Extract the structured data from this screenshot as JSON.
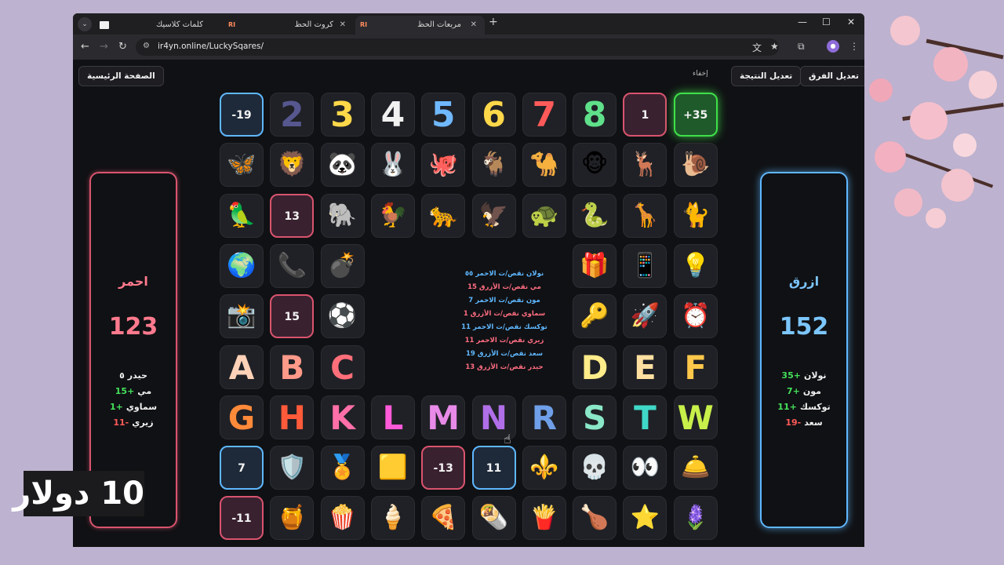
{
  "browser": {
    "tabs": [
      {
        "title": "كلمات كلاسيك",
        "active": false
      },
      {
        "title": "كروت الحظ",
        "active": false
      },
      {
        "title": "مربعات الحظ",
        "active": true
      }
    ],
    "url": "ir4yn.online/LuckySqares/"
  },
  "header": {
    "home_button": "الصفحة الرئيسية",
    "edit_score_button": "تعديل النتيجة",
    "edit_teams_button": "تعديل الفرق",
    "hide_label": "إخفاء"
  },
  "teams": {
    "red": {
      "name": "احمر",
      "score": "123",
      "color": "#ff7a8e",
      "players": [
        {
          "name": "حيدر",
          "value": "٥",
          "kind": "plain"
        },
        {
          "name": "مي",
          "value": "+15",
          "kind": "pos"
        },
        {
          "name": "سماوي",
          "value": "+1",
          "kind": "pos"
        },
        {
          "name": "زيري",
          "value": "-11",
          "kind": "neg"
        }
      ]
    },
    "blue": {
      "name": "ازرق",
      "score": "152",
      "color": "#7cc6ff",
      "players": [
        {
          "name": "نولان",
          "value": "+35",
          "kind": "pos"
        },
        {
          "name": "مون",
          "value": "+7",
          "kind": "pos"
        },
        {
          "name": "توكسك",
          "value": "+11",
          "kind": "pos"
        },
        {
          "name": "سعد",
          "value": "-19",
          "kind": "neg"
        }
      ]
    }
  },
  "grid": [
    [
      {
        "t": "-19",
        "k": "val",
        "s": "blue"
      },
      {
        "t": "2",
        "k": "num",
        "c": "#56578f"
      },
      {
        "t": "3",
        "k": "num",
        "c": "#ffd84a"
      },
      {
        "t": "4",
        "k": "num",
        "c": "#f1f1f1"
      },
      {
        "t": "5",
        "k": "num",
        "c": "#6fb8ff"
      },
      {
        "t": "6",
        "k": "num",
        "c": "#ffd84a"
      },
      {
        "t": "7",
        "k": "num",
        "c": "#ff5a5a"
      },
      {
        "t": "8",
        "k": "num",
        "c": "#5fe08a"
      },
      {
        "t": "1",
        "k": "val",
        "s": "red"
      },
      {
        "t": "+35",
        "k": "val",
        "s": "green"
      }
    ],
    [
      {
        "t": "🦋",
        "k": "emo"
      },
      {
        "t": "🦁",
        "k": "emo"
      },
      {
        "t": "🐼",
        "k": "emo"
      },
      {
        "t": "🐰",
        "k": "emo"
      },
      {
        "t": "🐙",
        "k": "emo"
      },
      {
        "t": "🐐",
        "k": "emo"
      },
      {
        "t": "🐪",
        "k": "emo"
      },
      {
        "t": "🐵",
        "k": "emo"
      },
      {
        "t": "🦌",
        "k": "emo"
      },
      {
        "t": "🐌",
        "k": "emo"
      }
    ],
    [
      {
        "t": "🦜",
        "k": "emo"
      },
      {
        "t": "13",
        "k": "val",
        "s": "red"
      },
      {
        "t": "🐘",
        "k": "emo"
      },
      {
        "t": "🐓",
        "k": "emo"
      },
      {
        "t": "🐆",
        "k": "emo"
      },
      {
        "t": "🦅",
        "k": "emo"
      },
      {
        "t": "🐢",
        "k": "emo"
      },
      {
        "t": "🐍",
        "k": "emo"
      },
      {
        "t": "🦒",
        "k": "emo"
      },
      {
        "t": "🐈",
        "k": "emo"
      }
    ],
    [
      {
        "t": "🌍",
        "k": "emo"
      },
      {
        "t": "📞",
        "k": "emo"
      },
      {
        "t": "💣",
        "k": "emo"
      },
      null,
      null,
      null,
      null,
      {
        "t": "🎁",
        "k": "emo"
      },
      {
        "t": "📱",
        "k": "emo"
      },
      {
        "t": "💡",
        "k": "emo"
      }
    ],
    [
      {
        "t": "📸",
        "k": "emo"
      },
      {
        "t": "15",
        "k": "val",
        "s": "red"
      },
      {
        "t": "⚽",
        "k": "emo"
      },
      null,
      null,
      null,
      null,
      {
        "t": "🔑",
        "k": "emo"
      },
      {
        "t": "🚀",
        "k": "emo"
      },
      {
        "t": "⏰",
        "k": "emo"
      }
    ],
    [
      {
        "t": "A",
        "k": "let",
        "c": "#ffd2b8"
      },
      {
        "t": "B",
        "k": "let",
        "c": "#ff9a8a"
      },
      {
        "t": "C",
        "k": "let",
        "c": "#ff6f7a"
      },
      null,
      null,
      null,
      null,
      {
        "t": "D",
        "k": "let",
        "c": "#ffec8a"
      },
      {
        "t": "E",
        "k": "let",
        "c": "#ffe0a0"
      },
      {
        "t": "F",
        "k": "let",
        "c": "#ffc84a"
      }
    ],
    [
      {
        "t": "G",
        "k": "let",
        "c": "#ff8a3a"
      },
      {
        "t": "H",
        "k": "let",
        "c": "#ff5a3a"
      },
      {
        "t": "K",
        "k": "let",
        "c": "#ff6fa8"
      },
      {
        "t": "L",
        "k": "let",
        "c": "#ff5ad8"
      },
      {
        "t": "M",
        "k": "let",
        "c": "#e88ae8"
      },
      {
        "t": "N",
        "k": "let",
        "c": "#b06fe8"
      },
      {
        "t": "R",
        "k": "let",
        "c": "#6f9fe8"
      },
      {
        "t": "S",
        "k": "let",
        "c": "#8ae8c8"
      },
      {
        "t": "T",
        "k": "let",
        "c": "#3fd8c8"
      },
      {
        "t": "W",
        "k": "let",
        "c": "#c8f04a"
      }
    ],
    [
      {
        "t": "7",
        "k": "val",
        "s": "blue"
      },
      {
        "t": "🛡️",
        "k": "emo"
      },
      {
        "t": "🏅",
        "k": "emo"
      },
      {
        "t": "🟨",
        "k": "emo"
      },
      {
        "t": "-13",
        "k": "val",
        "s": "red"
      },
      {
        "t": "11",
        "k": "val",
        "s": "blue"
      },
      {
        "t": "⚜️",
        "k": "emo"
      },
      {
        "t": "💀",
        "k": "emo"
      },
      {
        "t": "👀",
        "k": "emo"
      },
      {
        "t": "🛎️",
        "k": "emo"
      }
    ],
    [
      {
        "t": "-11",
        "k": "val",
        "s": "red"
      },
      {
        "t": "🍯",
        "k": "emo"
      },
      {
        "t": "🍿",
        "k": "emo"
      },
      {
        "t": "🍦",
        "k": "emo"
      },
      {
        "t": "🍕",
        "k": "emo"
      },
      {
        "t": "🌯",
        "k": "emo"
      },
      {
        "t": "🍟",
        "k": "emo"
      },
      {
        "t": "🍗",
        "k": "emo"
      },
      {
        "t": "⭐",
        "k": "emo"
      },
      {
        "t": "🪻",
        "k": "emo"
      }
    ]
  ],
  "log": [
    {
      "text": "نولان نقص/ت الاحمر ٥٥",
      "team": "blue"
    },
    {
      "text": "مي نقص/ت الأزرق 15",
      "team": "red"
    },
    {
      "text": "مون نقص/ت الاحمر 7",
      "team": "blue"
    },
    {
      "text": "سماوي نقص/ت الأزرق 1",
      "team": "red"
    },
    {
      "text": "توكسك نقص/ت الاحمر 11",
      "team": "blue"
    },
    {
      "text": "زيري نقص/ت الاحمر 11",
      "team": "red"
    },
    {
      "text": "سعد نقص/ت الأزرق 19",
      "team": "blue"
    },
    {
      "text": "حيدر نقص/ت الأزرق 13",
      "team": "red"
    }
  ],
  "badge": "10 دولار"
}
